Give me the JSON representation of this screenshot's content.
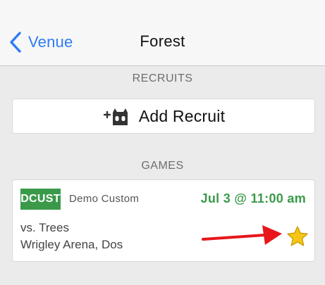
{
  "nav": {
    "back_label": "Venue",
    "title": "Forest",
    "tint_color": "#2d7cf6"
  },
  "recruits": {
    "section_header": "RECRUITS",
    "add_label": "Add Recruit",
    "add_icon": "add-recruit-icon"
  },
  "games": {
    "section_header": "GAMES",
    "items": [
      {
        "team_abbrev": "DCUST",
        "team_name": "Demo Custom",
        "date_time": "Jul 3 @ 11:00 am",
        "opponent": "vs. Trees",
        "location": "Wrigley Arena, Dos",
        "favorite_icon": "star-icon",
        "accent_color": "#3a9a4a"
      }
    ]
  },
  "annotation": {
    "arrow_color": "#e8161b",
    "arrow_icon": "red-arrow-annotation"
  }
}
